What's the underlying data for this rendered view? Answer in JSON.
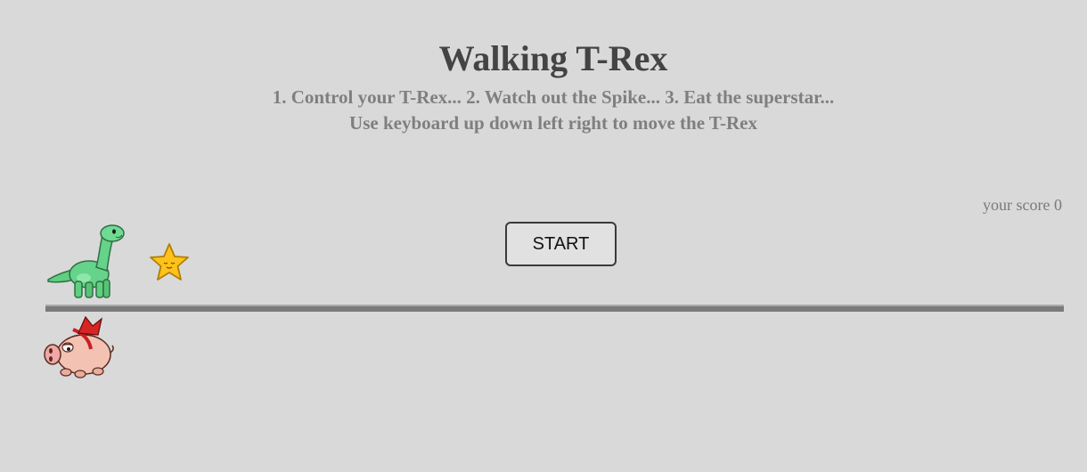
{
  "game": {
    "title": "Walking T-Rex",
    "instructions_line1": "1. Control your T-Rex... 2. Watch out the Spike... 3. Eat the superstar...",
    "instructions_line2": "Use keyboard up down left right to move the T-Rex",
    "score_text": "your score 0",
    "start_label": "START"
  },
  "colors": {
    "background": "#d9d9d9",
    "title": "#444444",
    "subtitle": "#7f7f7f",
    "ground": "#7a7a7a"
  },
  "sprites": {
    "player": "dinosaur-sprite",
    "collectible": "star-sprite",
    "enemy": "pig-spike-sprite"
  }
}
